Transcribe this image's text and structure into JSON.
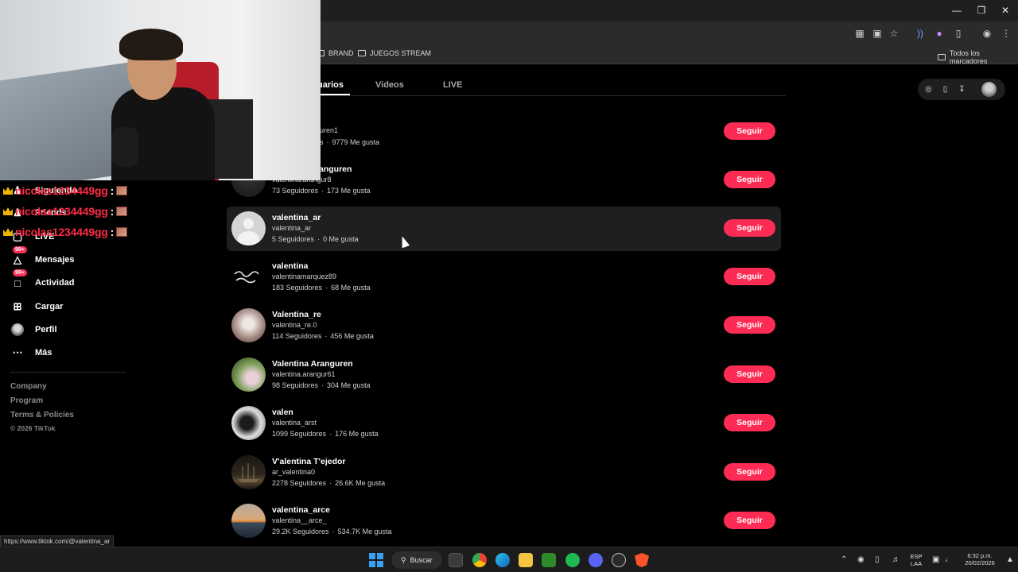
{
  "bookmarks": [
    "BRAND",
    "JUEGOS STREAM"
  ],
  "bookmarks_right": "Todos los marcadores",
  "chat": [
    {
      "user": "nicolas1234449gg",
      "sep": ":"
    },
    {
      "user": "nicolas1234449gg",
      "sep": ":"
    },
    {
      "user": "nicolas1234449gg",
      "sep": ":"
    }
  ],
  "sidebar": {
    "items": [
      {
        "label": "Siguiendo",
        "icon": "following-icon"
      },
      {
        "label": "Friends",
        "icon": "friends-icon"
      },
      {
        "label": "LIVE",
        "icon": "live-icon"
      },
      {
        "label": "Mensajes",
        "icon": "messages-icon",
        "badge": "99+"
      },
      {
        "label": "Actividad",
        "icon": "activity-icon",
        "badge": "99+"
      },
      {
        "label": "Cargar",
        "icon": "upload-icon"
      },
      {
        "label": "Perfil",
        "icon": "profile-avatar"
      },
      {
        "label": "Más",
        "icon": "more-icon"
      }
    ],
    "footer": [
      "Company",
      "Program",
      "Terms & Policies",
      "© 2026 TikTok"
    ]
  },
  "tabs": {
    "users": "uarios",
    "videos": "Videos",
    "live": "LIVE"
  },
  "follow_label": "Seguir",
  "results": [
    {
      "name": "",
      "handle": "guren1",
      "followers": "es",
      "likes": "9779 Me gusta",
      "avatar": "none"
    },
    {
      "name": "anguren",
      "handle": "valentina.arangur8",
      "followers": "73 Seguidores",
      "likes": "173 Me gusta",
      "avatar": "dark"
    },
    {
      "name": "valentina_ar",
      "handle": "valentina_ar",
      "followers": "5 Seguidores",
      "likes": "0 Me gusta",
      "avatar": "default"
    },
    {
      "name": "valentina",
      "handle": "valentinamarquez89",
      "followers": "183 Seguidores",
      "likes": "68 Me gusta",
      "avatar": "script"
    },
    {
      "name": "Valentina_re",
      "handle": "valentina_re.0",
      "followers": "114 Seguidores",
      "likes": "456 Me gusta",
      "avatar": "photo-light"
    },
    {
      "name": "Valentina Aranguren",
      "handle": "valentina.arangur61",
      "followers": "98 Seguidores",
      "likes": "304 Me gusta",
      "avatar": "photo-green"
    },
    {
      "name": "valen",
      "handle": "valentina_arst",
      "followers": "1099 Seguidores",
      "likes": "176 Me gusta",
      "avatar": "photo-bw"
    },
    {
      "name": "V'alentina T'ejedor",
      "handle": "ar_valentina0",
      "followers": "2278 Seguidores",
      "likes": "26.6K Me gusta",
      "avatar": "ship"
    },
    {
      "name": "valentina_arce",
      "handle": "valentina__arce_",
      "followers": "29.2K Seguidores",
      "likes": "534.7K Me gusta",
      "avatar": "sunset"
    }
  ],
  "status_url": "https://www.tiktok.com/@valentina_ar",
  "taskbar": {
    "search": "Buscar",
    "lang": "ESP",
    "lang2": "LAA",
    "time": "6:32 p.m.",
    "date": "20/02/2026"
  },
  "colors": {
    "accent": "#fe2c55",
    "chat_name": "#ff2b45"
  }
}
